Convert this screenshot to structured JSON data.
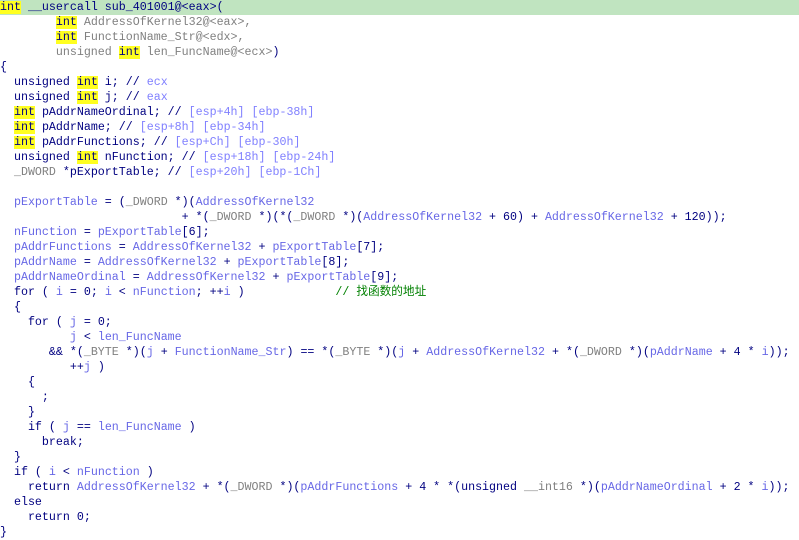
{
  "colors": {
    "keyword": "#000080",
    "variable": "#6767e6",
    "type": "#808080",
    "highlight": "#ffff20",
    "comment_cjk": "#008000",
    "current_line": "#c0e4c0"
  },
  "current_line": 0,
  "lines": [
    [
      [
        "h",
        "int"
      ],
      [
        "k",
        " __usercall sub_401001@<eax>("
      ]
    ],
    [
      [
        "k",
        "        "
      ],
      [
        "h",
        "int"
      ],
      [
        "g",
        " AddressOfKernel32@<eax>,"
      ]
    ],
    [
      [
        "k",
        "        "
      ],
      [
        "h",
        "int"
      ],
      [
        "g",
        " FunctionName_Str@<edx>,"
      ]
    ],
    [
      [
        "g",
        "        unsigned "
      ],
      [
        "h",
        "int"
      ],
      [
        "g",
        " len_FuncName@<ecx>"
      ],
      [
        "k",
        ")"
      ]
    ],
    [
      [
        "k",
        "{"
      ]
    ],
    [
      [
        "k",
        "  unsigned "
      ],
      [
        "h",
        "int"
      ],
      [
        "k",
        " i; // "
      ],
      [
        "c",
        "ecx"
      ]
    ],
    [
      [
        "k",
        "  unsigned "
      ],
      [
        "h",
        "int"
      ],
      [
        "k",
        " j; // "
      ],
      [
        "c",
        "eax"
      ]
    ],
    [
      [
        "k",
        "  "
      ],
      [
        "h",
        "int"
      ],
      [
        "k",
        " pAddrNameOrdinal; // "
      ],
      [
        "c",
        "[esp+4h] [ebp-38h]"
      ]
    ],
    [
      [
        "k",
        "  "
      ],
      [
        "h",
        "int"
      ],
      [
        "k",
        " pAddrName; // "
      ],
      [
        "c",
        "[esp+8h] [ebp-34h]"
      ]
    ],
    [
      [
        "k",
        "  "
      ],
      [
        "h",
        "int"
      ],
      [
        "k",
        " pAddrFunctions; // "
      ],
      [
        "c",
        "[esp+Ch] [ebp-30h]"
      ]
    ],
    [
      [
        "k",
        "  unsigned "
      ],
      [
        "h",
        "int"
      ],
      [
        "k",
        " nFunction; // "
      ],
      [
        "c",
        "[esp+18h] [ebp-24h]"
      ]
    ],
    [
      [
        "g",
        "  _DWORD "
      ],
      [
        "k",
        "*pExportTable; // "
      ],
      [
        "c",
        "[esp+20h] [ebp-1Ch]"
      ]
    ],
    [],
    [
      [
        "v",
        "  pExportTable"
      ],
      [
        "k",
        " = ("
      ],
      [
        "g",
        "_DWORD"
      ],
      [
        "k",
        " *)("
      ],
      [
        "v",
        "AddressOfKernel32"
      ]
    ],
    [
      [
        "k",
        "                          + *("
      ],
      [
        "g",
        "_DWORD"
      ],
      [
        "k",
        " *)(*("
      ],
      [
        "g",
        "_DWORD"
      ],
      [
        "k",
        " *)("
      ],
      [
        "v",
        "AddressOfKernel32"
      ],
      [
        "k",
        " + 60) + "
      ],
      [
        "v",
        "AddressOfKernel32"
      ],
      [
        "k",
        " + 120));"
      ]
    ],
    [
      [
        "v",
        "  nFunction"
      ],
      [
        "k",
        " = "
      ],
      [
        "v",
        "pExportTable"
      ],
      [
        "k",
        "[6];"
      ]
    ],
    [
      [
        "v",
        "  pAddrFunctions"
      ],
      [
        "k",
        " = "
      ],
      [
        "v",
        "AddressOfKernel32"
      ],
      [
        "k",
        " + "
      ],
      [
        "v",
        "pExportTable"
      ],
      [
        "k",
        "[7];"
      ]
    ],
    [
      [
        "v",
        "  pAddrName"
      ],
      [
        "k",
        " = "
      ],
      [
        "v",
        "AddressOfKernel32"
      ],
      [
        "k",
        " + "
      ],
      [
        "v",
        "pExportTable"
      ],
      [
        "k",
        "[8];"
      ]
    ],
    [
      [
        "v",
        "  pAddrNameOrdinal"
      ],
      [
        "k",
        " = "
      ],
      [
        "v",
        "AddressOfKernel32"
      ],
      [
        "k",
        " + "
      ],
      [
        "v",
        "pExportTable"
      ],
      [
        "k",
        "[9];"
      ]
    ],
    [
      [
        "k",
        "  for ( "
      ],
      [
        "v",
        "i"
      ],
      [
        "k",
        " = 0; "
      ],
      [
        "v",
        "i"
      ],
      [
        "k",
        " < "
      ],
      [
        "v",
        "nFunction"
      ],
      [
        "k",
        "; ++"
      ],
      [
        "v",
        "i"
      ],
      [
        "k",
        " )             "
      ],
      [
        "z",
        "// 找函数的地址"
      ]
    ],
    [
      [
        "k",
        "  {"
      ]
    ],
    [
      [
        "k",
        "    for ( "
      ],
      [
        "v",
        "j"
      ],
      [
        "k",
        " = 0;"
      ]
    ],
    [
      [
        "k",
        "          "
      ],
      [
        "v",
        "j"
      ],
      [
        "k",
        " < "
      ],
      [
        "v",
        "len_FuncName"
      ]
    ],
    [
      [
        "k",
        "       && *("
      ],
      [
        "g",
        "_BYTE"
      ],
      [
        "k",
        " *)("
      ],
      [
        "v",
        "j"
      ],
      [
        "k",
        " + "
      ],
      [
        "v",
        "FunctionName_Str"
      ],
      [
        "k",
        ") == *("
      ],
      [
        "g",
        "_BYTE"
      ],
      [
        "k",
        " *)("
      ],
      [
        "v",
        "j"
      ],
      [
        "k",
        " + "
      ],
      [
        "v",
        "AddressOfKernel32"
      ],
      [
        "k",
        " + *("
      ],
      [
        "g",
        "_DWORD"
      ],
      [
        "k",
        " *)("
      ],
      [
        "v",
        "pAddrName"
      ],
      [
        "k",
        " + 4 * "
      ],
      [
        "v",
        "i"
      ],
      [
        "k",
        "));"
      ]
    ],
    [
      [
        "k",
        "          ++"
      ],
      [
        "v",
        "j"
      ],
      [
        "k",
        " )"
      ]
    ],
    [
      [
        "k",
        "    {"
      ]
    ],
    [
      [
        "k",
        "      ;"
      ]
    ],
    [
      [
        "k",
        "    }"
      ]
    ],
    [
      [
        "k",
        "    if ( "
      ],
      [
        "v",
        "j"
      ],
      [
        "k",
        " == "
      ],
      [
        "v",
        "len_FuncName"
      ],
      [
        "k",
        " )"
      ]
    ],
    [
      [
        "k",
        "      break;"
      ]
    ],
    [
      [
        "k",
        "  }"
      ]
    ],
    [
      [
        "k",
        "  if ( "
      ],
      [
        "v",
        "i"
      ],
      [
        "k",
        " < "
      ],
      [
        "v",
        "nFunction"
      ],
      [
        "k",
        " )"
      ]
    ],
    [
      [
        "k",
        "    return "
      ],
      [
        "v",
        "AddressOfKernel32"
      ],
      [
        "k",
        " + *("
      ],
      [
        "g",
        "_DWORD"
      ],
      [
        "k",
        " *)("
      ],
      [
        "v",
        "pAddrFunctions"
      ],
      [
        "k",
        " + 4 * *(unsigned "
      ],
      [
        "g",
        "__int16"
      ],
      [
        "k",
        " *)("
      ],
      [
        "v",
        "pAddrNameOrdinal"
      ],
      [
        "k",
        " + 2 * "
      ],
      [
        "v",
        "i"
      ],
      [
        "k",
        "));"
      ]
    ],
    [
      [
        "k",
        "  else"
      ]
    ],
    [
      [
        "k",
        "    return 0;"
      ]
    ],
    [
      [
        "k",
        "}"
      ]
    ]
  ]
}
